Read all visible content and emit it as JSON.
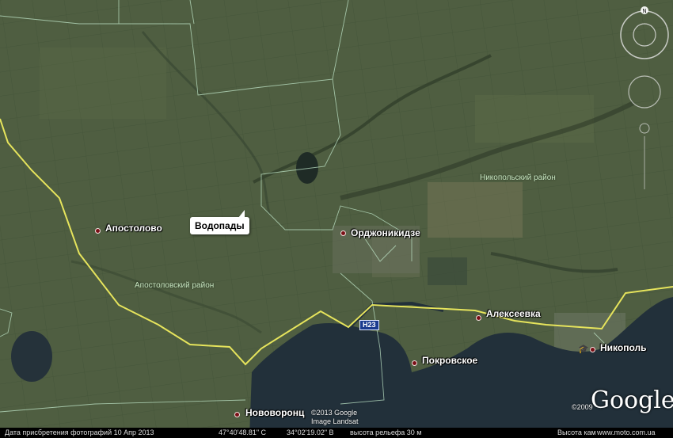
{
  "places": {
    "apostolovo": "Апостолово",
    "ordzhonikidze": "Орджоникидзе",
    "alekseevka": "Алексеевка",
    "nikopol": "Никополь",
    "pokrovskoe": "Покровское",
    "novovorontsovka": "Нововоронц"
  },
  "districts": {
    "nikopolsky": "Никопольский район",
    "apostolovsky": "Апостоловский район"
  },
  "callout": "Водопады",
  "road_label": "H23",
  "logo": "Google",
  "copyright": {
    "line1": "©2013 Google",
    "line2": "Image Landsat",
    "year2009": "©2009"
  },
  "status_bar": {
    "date": "Дата присбретения фотографий  10 Апр 2013",
    "lat": "47°40'48.81\" С",
    "lon": "34°02'19.02\" В",
    "elevation": "высота рельефа   30 м",
    "eye_alt": "Высота кам",
    "watermark": "www.moto.com.ua"
  },
  "colors": {
    "land": "#4a5a3e",
    "water": "#22303a",
    "border": "#e4e25a",
    "marker": "#7a0f16"
  }
}
